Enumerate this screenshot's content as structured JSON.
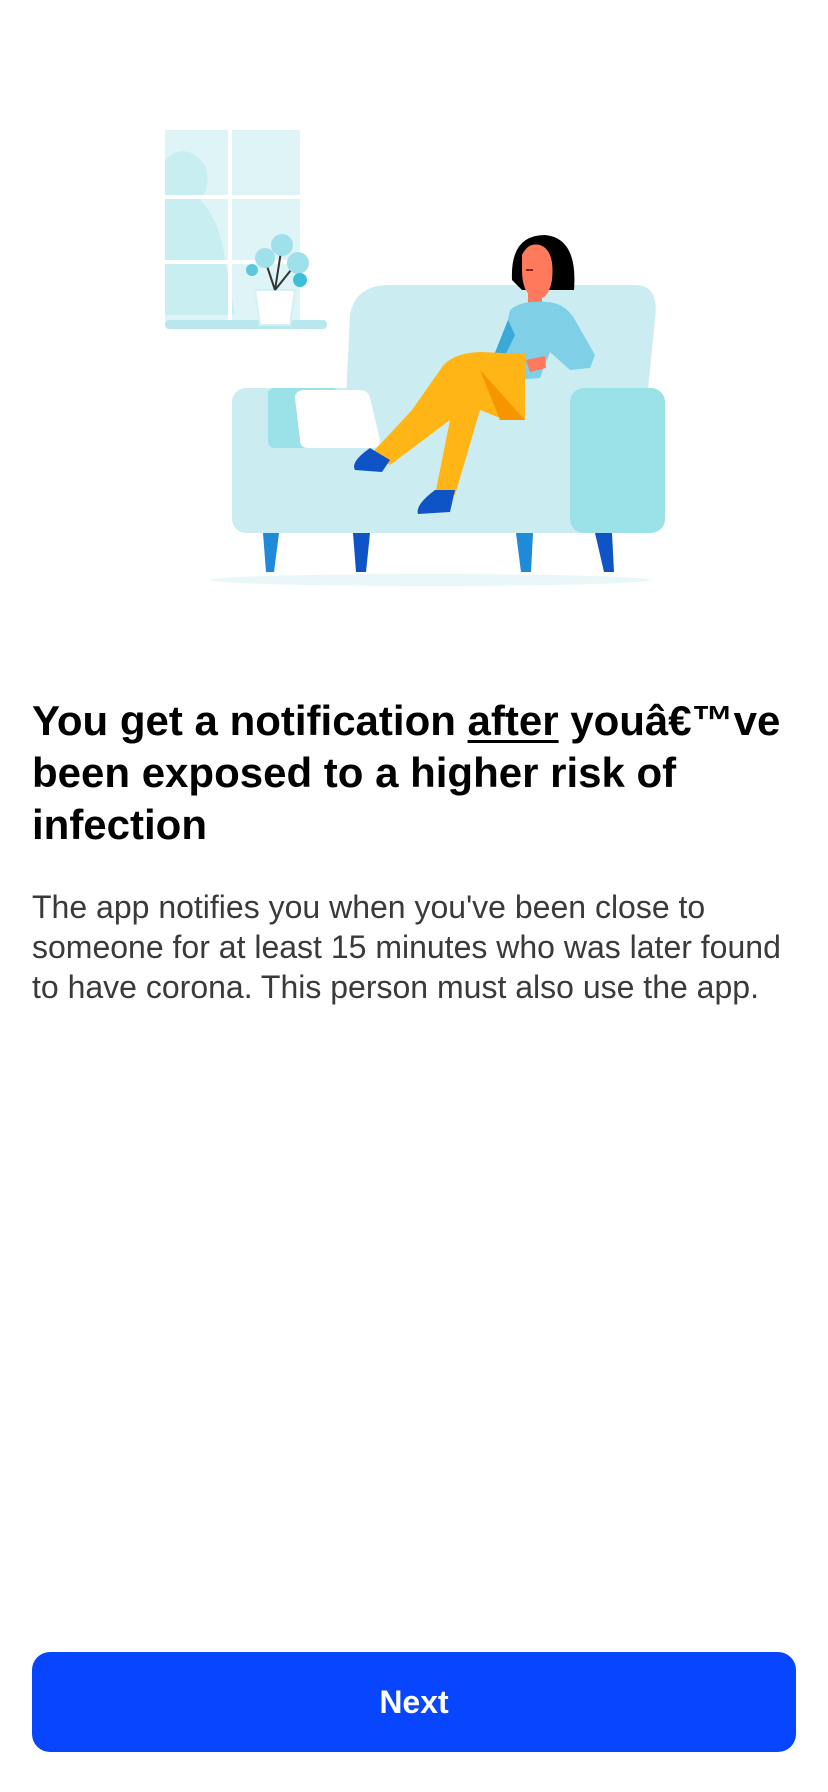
{
  "onboarding": {
    "heading": {
      "part1": "You get a notification ",
      "emphasis": "after",
      "part2": " youâ€™ve been exposed to a higher risk of infection"
    },
    "body": "The app notifies you when you've been close to someone for at least 15 minutes who was later found to have corona. This person must also use the app."
  },
  "actions": {
    "next_label": "Next"
  },
  "illustration": {
    "icon": "woman-on-sofa-illustration",
    "colors": {
      "sofa": "#cbedf1",
      "sofa_dark": "#9be1e8",
      "legs": "#1e6fd9",
      "pants": "#ffb515",
      "shirt": "#7fcfe6",
      "skin": "#ff7a5c",
      "hair": "#000000",
      "window": "#dff4f7"
    }
  },
  "theme": {
    "accent": "#0845ff"
  }
}
